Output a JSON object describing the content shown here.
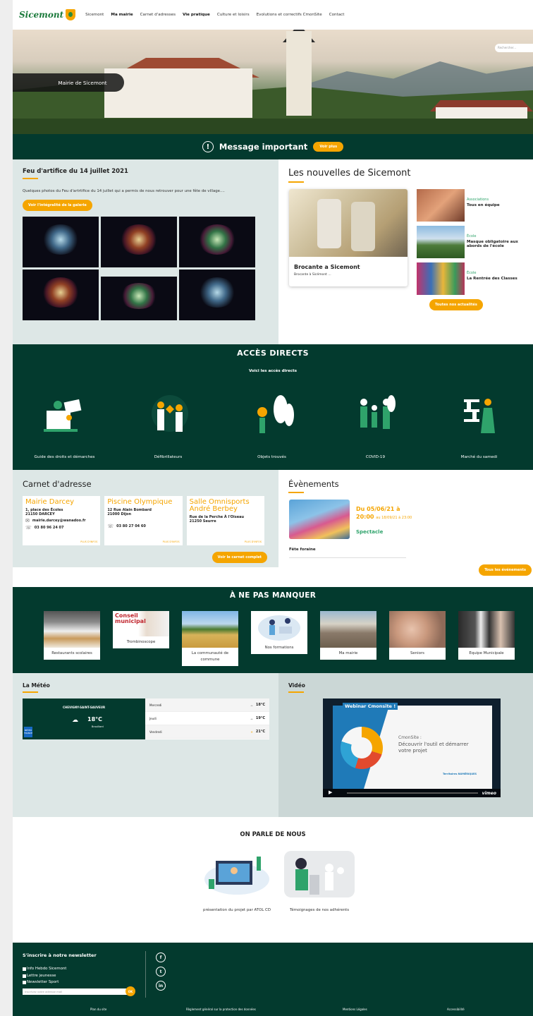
{
  "header": {
    "logo": "Sicemont",
    "nav": [
      {
        "label": "Sicemont",
        "bold": false
      },
      {
        "label": "Ma mairie",
        "bold": true
      },
      {
        "label": "Carnet d'adresses",
        "bold": false
      },
      {
        "label": "Vie pratique",
        "bold": true
      },
      {
        "label": "Culture et loisirs",
        "bold": false
      },
      {
        "label": "Evolutions et correctifs CmonSite",
        "bold": false
      },
      {
        "label": "Contact",
        "bold": false
      }
    ],
    "search_placeholder": "Rechercher..."
  },
  "hero": {
    "label": "Mairie de Sicemont"
  },
  "message": {
    "title": "Message important",
    "button": "Voir plus"
  },
  "feu": {
    "title": "Feu d'artifice du 14 juillet 2021",
    "text": "Quelques photos du Feu d'artrtifice du 14 juillet qui a permis de nous retrouver pour une fête de village....",
    "button": "Voir l'intégralité de la galerie"
  },
  "news": {
    "title": "Les nouvelles de Sicemont",
    "main": {
      "title": "Brocante a Sicemont",
      "text": "Brocante à Sicémont ..."
    },
    "items": [
      {
        "category": "Associations",
        "title": "Tous en équipe"
      },
      {
        "category": "École",
        "title": "Masque obligatoire aux abords de l'école"
      },
      {
        "category": "École",
        "title": "La Rentrée des Classes"
      }
    ],
    "button": "Toutes nos actualités"
  },
  "acces": {
    "title": "ACCÈS DIRECTS",
    "subtitle": "Voici les accès directs",
    "items": [
      {
        "label": "Guide des droits et démarches"
      },
      {
        "label": "Défibrillateurs"
      },
      {
        "label": "Objets trouvés"
      },
      {
        "label": "COVID-19"
      },
      {
        "label": "Marché du samedi"
      }
    ]
  },
  "carnet": {
    "title": "Carnet d'adresse",
    "cards": [
      {
        "name": "Mairie Darcey",
        "address": "1, place des Écoles\n21150 DARCEY",
        "email": "mairie.darcey@wanadoo.fr",
        "phone": "03 80 96 24 07",
        "more": "PLUS D'INFOS"
      },
      {
        "name": "Piscine Olympique",
        "address": "12 Rue Alain Bombard\n21000 Dijon",
        "email": "",
        "phone": "03 80 27 04 60",
        "more": "PLUS D'INFOS"
      },
      {
        "name": "Salle Omnisports André Berbey",
        "address": "Rue de la Perche À l'Oiseau\n21250 Seurre",
        "email": "",
        "phone": "",
        "more": "PLUS D'INFOS"
      }
    ],
    "button": "Voir le carnet complet"
  },
  "events": {
    "title": "Évènements",
    "date_main": "Du 05/06/21 à 20:00",
    "date_end": "au 18/09/21 à 23:00",
    "type": "Spectacle",
    "name": "Fête foraine",
    "button": "Tous les événements"
  },
  "anpm": {
    "title": "À NE PAS MANQUER",
    "items": [
      {
        "label": "Restaurants scolaires"
      },
      {
        "label": "Trombinoscope"
      },
      {
        "label": "La communauté de commune"
      },
      {
        "label": "Nos formations"
      },
      {
        "label": "Ma mairie"
      },
      {
        "label": "Seniors"
      },
      {
        "label": "Equipe Municipale"
      }
    ],
    "trombi_overlay": "Conseil municipal"
  },
  "meteo": {
    "title": "La Météo",
    "city": "CHEVIGNY-SAINT-SAUVEUR",
    "temp": "18°C",
    "desc": "Brouillard",
    "provider": "MÉTÉO FRANCE",
    "days": [
      {
        "day": "Mercredi",
        "temp": "18°C"
      },
      {
        "day": "Jeudi",
        "temp": "19°C"
      },
      {
        "day": "Vendredi",
        "temp": "21°C"
      }
    ]
  },
  "video": {
    "title": "Vidéo",
    "webinar_title": "Webinar Cmonsite !",
    "line1": "CmonSite :",
    "line2": "Découvrir l'outil et démarrer votre projet",
    "brand": "Territoires NUMÉRIQUES",
    "player": "vimeo"
  },
  "onparle": {
    "title": "ON PARLE DE NOUS",
    "items": [
      {
        "label": "présentation du projet par ATOL CD"
      },
      {
        "label": "Témoignages de nos adhérents"
      }
    ]
  },
  "footer": {
    "newsletter_title": "S'inscrire à notre newsletter",
    "lists": [
      "Info Hebdo Sicemont",
      "Lettre jeunesse",
      "Newsletter Sport"
    ],
    "email_placeholder": "Inscrivez votre adresse mail",
    "ok": "OK",
    "social": [
      "f",
      "t",
      "in"
    ],
    "links": [
      "Plan du site",
      "Règlement général sur la protection des données",
      "Mentions Légales",
      "Accessibilité"
    ]
  },
  "colors": {
    "green": "#033a2e",
    "orange": "#f5a500",
    "light": "#dde7e6",
    "accent": "#2fa36b"
  }
}
